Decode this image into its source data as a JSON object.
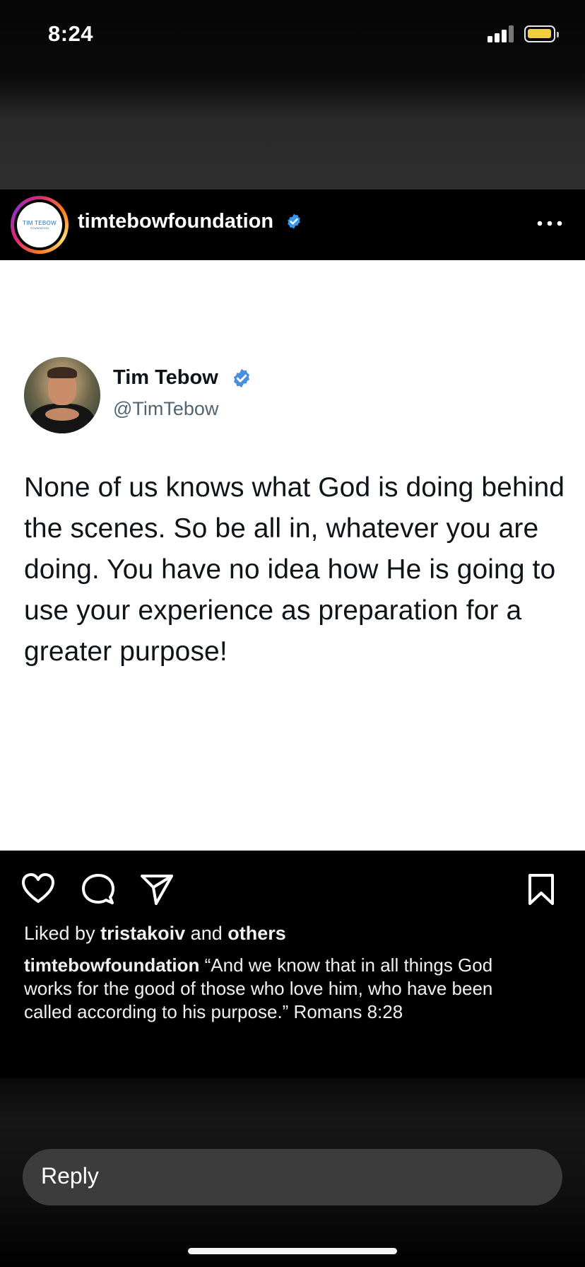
{
  "status_bar": {
    "time": "8:24",
    "battery_color": "#f2cf3f"
  },
  "post": {
    "account": {
      "username": "timtebowfoundation",
      "avatar_logo_title": "TIM TEBOW",
      "avatar_logo_sub": "FOUNDATION",
      "verified": true,
      "more_icon": "more-horizontal-icon"
    },
    "tweet": {
      "name": "Tim Tebow",
      "handle": "@TimTebow",
      "verified_color": "#1d9bf0",
      "text": "None of us knows what God is doing behind the scenes. So be all in, whatever you are doing. You have no idea how He is going to use your experience as preparation for a greater purpose!"
    },
    "actions": {
      "like_icon": "heart-icon",
      "comment_icon": "comment-icon",
      "share_icon": "send-icon",
      "save_icon": "bookmark-icon"
    },
    "likes": {
      "prefix": "Liked by",
      "user": "tristakoiv",
      "middle": "and",
      "others": "others"
    },
    "caption": {
      "username": "timtebowfoundation",
      "text": "“And we know that in all things God works for the good of those who love him, who have been called according to his purpose.” Romans 8:28"
    }
  },
  "reply": {
    "placeholder": "Reply"
  }
}
